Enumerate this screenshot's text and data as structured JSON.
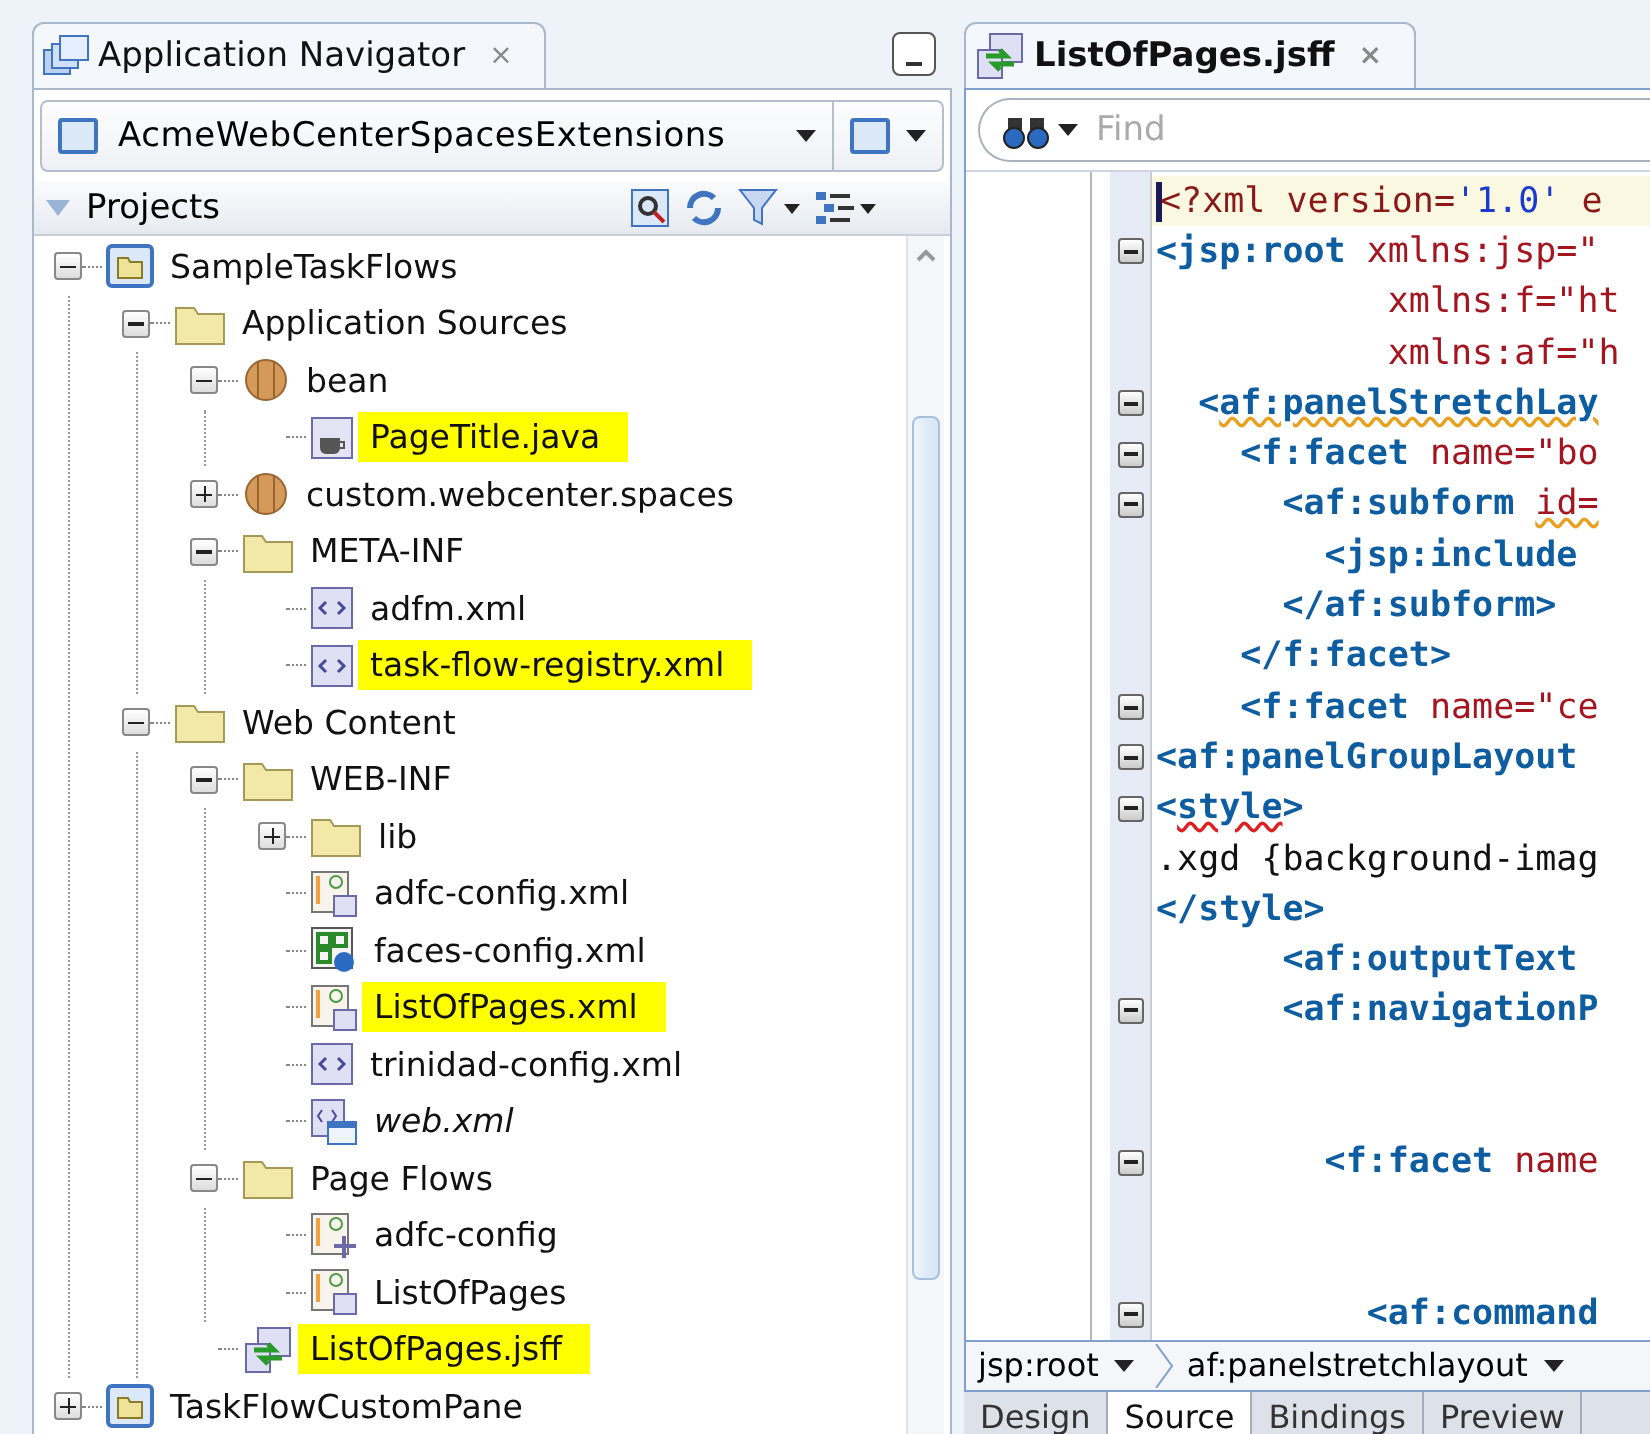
{
  "navigator": {
    "tab": {
      "title": "Application Navigator",
      "close": "×"
    },
    "application": {
      "name": "AcmeWebCenterSpacesExtensions"
    },
    "section": {
      "title": "Projects",
      "expanded": true
    },
    "tree": [
      {
        "label": "SampleTaskFlows",
        "kind": "project",
        "expanded": true,
        "highlighted": false,
        "italic": false,
        "children": [
          {
            "label": "Application Sources",
            "kind": "folder",
            "expanded": true,
            "highlighted": false,
            "italic": false,
            "children": [
              {
                "label": "bean",
                "kind": "package",
                "expanded": true,
                "highlighted": false,
                "italic": false,
                "children": [
                  {
                    "label": "PageTitle.java",
                    "kind": "java",
                    "highlighted": true,
                    "italic": false
                  }
                ]
              },
              {
                "label": "custom.webcenter.spaces",
                "kind": "package",
                "expanded": false,
                "highlighted": false,
                "italic": false
              },
              {
                "label": "META-INF",
                "kind": "folder",
                "expanded": true,
                "highlighted": false,
                "italic": false,
                "children": [
                  {
                    "label": "adfm.xml",
                    "kind": "xml",
                    "highlighted": false,
                    "italic": false
                  },
                  {
                    "label": "task-flow-registry.xml",
                    "kind": "xml",
                    "highlighted": true,
                    "italic": false
                  }
                ]
              }
            ]
          },
          {
            "label": "Web Content",
            "kind": "folder",
            "expanded": true,
            "highlighted": false,
            "italic": false,
            "children": [
              {
                "label": "WEB-INF",
                "kind": "folder",
                "expanded": true,
                "highlighted": false,
                "italic": false,
                "children": [
                  {
                    "label": "lib",
                    "kind": "folder",
                    "expanded": false,
                    "highlighted": false,
                    "italic": false
                  },
                  {
                    "label": "adfc-config.xml",
                    "kind": "diagram",
                    "highlighted": false,
                    "italic": false
                  },
                  {
                    "label": "faces-config.xml",
                    "kind": "faces",
                    "highlighted": false,
                    "italic": false
                  },
                  {
                    "label": "ListOfPages.xml",
                    "kind": "diagram",
                    "highlighted": true,
                    "italic": false
                  },
                  {
                    "label": "trinidad-config.xml",
                    "kind": "xml",
                    "highlighted": false,
                    "italic": false
                  },
                  {
                    "label": "web.xml",
                    "kind": "webxml",
                    "highlighted": false,
                    "italic": true
                  }
                ]
              },
              {
                "label": "Page Flows",
                "kind": "folder",
                "expanded": true,
                "highlighted": false,
                "italic": false,
                "children": [
                  {
                    "label": "adfc-config",
                    "kind": "flow",
                    "highlighted": false,
                    "italic": false
                  },
                  {
                    "label": "ListOfPages",
                    "kind": "diagram",
                    "highlighted": false,
                    "italic": false
                  }
                ]
              },
              {
                "label": "ListOfPages.jsff",
                "kind": "jsff",
                "highlighted": true,
                "italic": false
              }
            ]
          }
        ]
      },
      {
        "label": "TaskFlowCustomPane",
        "kind": "project",
        "expanded": false,
        "highlighted": false,
        "italic": false
      }
    ]
  },
  "editor": {
    "tab": {
      "title": "ListOfPages.jsff",
      "close": "×"
    },
    "find": {
      "placeholder": "Find"
    },
    "lines": [
      {
        "fold": false,
        "current": true,
        "tokens": [
          {
            "kind": "pi",
            "text": "<?xml version=",
            "warning": false,
            "error": false
          },
          {
            "kind": "value",
            "text": "'1.0'",
            "warning": false,
            "error": false
          },
          {
            "kind": "pi",
            "text": " e",
            "warning": false,
            "error": false
          }
        ]
      },
      {
        "fold": true,
        "current": false,
        "tokens": [
          {
            "kind": "tag",
            "text": "<jsp:root",
            "warning": false,
            "error": false
          },
          {
            "kind": "attr",
            "text": " xmlns:jsp=\"",
            "warning": false,
            "error": false
          }
        ]
      },
      {
        "fold": false,
        "current": false,
        "tokens": [
          {
            "kind": "attr",
            "text": "           xmlns:f=\"ht",
            "warning": false,
            "error": false
          }
        ]
      },
      {
        "fold": false,
        "current": false,
        "tokens": [
          {
            "kind": "attr",
            "text": "           xmlns:af=\"h",
            "warning": false,
            "error": false
          }
        ]
      },
      {
        "fold": true,
        "current": false,
        "tokens": [
          {
            "kind": "tag",
            "text": "  <",
            "warning": false,
            "error": false
          },
          {
            "kind": "tag",
            "text": "af:panelStretchLay",
            "warning": true,
            "error": false
          }
        ]
      },
      {
        "fold": true,
        "current": false,
        "tokens": [
          {
            "kind": "tag",
            "text": "    <f:facet",
            "warning": false,
            "error": false
          },
          {
            "kind": "attr",
            "text": " name=\"bo",
            "warning": false,
            "error": false
          }
        ]
      },
      {
        "fold": true,
        "current": false,
        "tokens": [
          {
            "kind": "tag",
            "text": "      <af:subform ",
            "warning": false,
            "error": false
          },
          {
            "kind": "attr",
            "text": "id=",
            "warning": true,
            "error": false
          }
        ]
      },
      {
        "fold": false,
        "current": false,
        "tokens": [
          {
            "kind": "tag",
            "text": "        <jsp:include",
            "warning": false,
            "error": false
          }
        ]
      },
      {
        "fold": false,
        "current": false,
        "tokens": [
          {
            "kind": "tag",
            "text": "      </af:subform>",
            "warning": false,
            "error": false
          }
        ]
      },
      {
        "fold": false,
        "current": false,
        "tokens": [
          {
            "kind": "tag",
            "text": "    </f:facet>",
            "warning": false,
            "error": false
          }
        ]
      },
      {
        "fold": true,
        "current": false,
        "tokens": [
          {
            "kind": "tag",
            "text": "    <f:facet",
            "warning": false,
            "error": false
          },
          {
            "kind": "attr",
            "text": " name=\"ce",
            "warning": false,
            "error": false
          }
        ]
      },
      {
        "fold": true,
        "current": false,
        "tokens": [
          {
            "kind": "tag",
            "text": "<af:panelGroupLayout",
            "warning": false,
            "error": false
          }
        ]
      },
      {
        "fold": true,
        "current": false,
        "tokens": [
          {
            "kind": "tag",
            "text": "<",
            "warning": false,
            "error": false
          },
          {
            "kind": "tag",
            "text": "style",
            "warning": false,
            "error": true
          },
          {
            "kind": "tag",
            "text": ">",
            "warning": false,
            "error": false
          }
        ]
      },
      {
        "fold": false,
        "current": false,
        "tokens": [
          {
            "kind": "text",
            "text": ".xgd {background-imag",
            "warning": false,
            "error": false
          }
        ]
      },
      {
        "fold": false,
        "current": false,
        "tokens": [
          {
            "kind": "tag",
            "text": "</style>",
            "warning": false,
            "error": false
          }
        ]
      },
      {
        "fold": false,
        "current": false,
        "tokens": [
          {
            "kind": "tag",
            "text": "      <af:outputText",
            "warning": false,
            "error": false
          }
        ]
      },
      {
        "fold": true,
        "current": false,
        "tokens": [
          {
            "kind": "tag",
            "text": "      <af:navigationP",
            "warning": false,
            "error": false
          }
        ]
      },
      {
        "fold": false,
        "current": false
      },
      {
        "fold": false,
        "current": false
      },
      {
        "fold": true,
        "current": false,
        "tokens": [
          {
            "kind": "tag",
            "text": "        <f:facet",
            "warning": false,
            "error": false
          },
          {
            "kind": "attr",
            "text": " name",
            "warning": false,
            "error": false
          }
        ]
      },
      {
        "fold": false,
        "current": false
      },
      {
        "fold": false,
        "current": false
      },
      {
        "fold": true,
        "current": false,
        "tokens": [
          {
            "kind": "tag",
            "text": "          <af:command",
            "warning": false,
            "error": false
          }
        ]
      }
    ],
    "breadcrumb": [
      {
        "label": "jsp:root"
      },
      {
        "label": "af:panelstretchlayout"
      }
    ],
    "tabs": [
      {
        "label": "Design",
        "selected": false
      },
      {
        "label": "Source",
        "selected": true
      },
      {
        "label": "Bindings",
        "selected": false
      },
      {
        "label": "Preview",
        "selected": false
      }
    ]
  }
}
